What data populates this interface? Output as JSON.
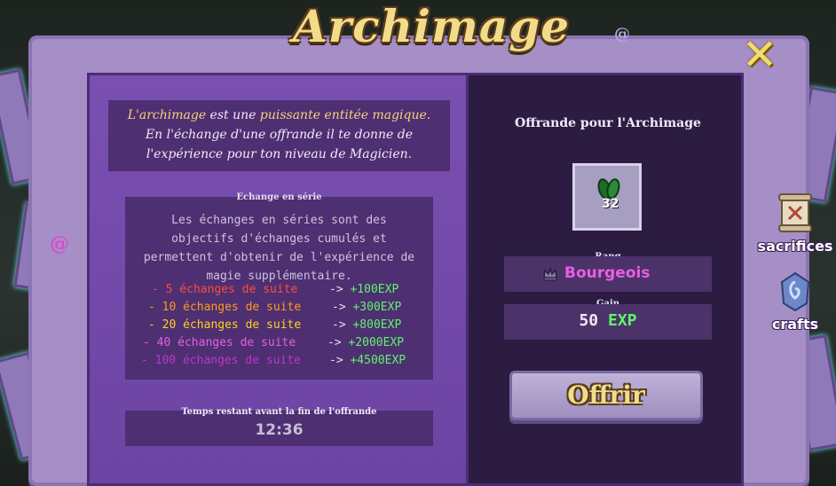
{
  "window": {
    "title": "Archimage",
    "close_glyph": "✕"
  },
  "intro": {
    "line1_a": "L'archimage",
    "line1_b": " est une ",
    "line1_c": "puissante entitée magique.",
    "line2": "En l'échange d'une offrande il te donne de",
    "line3": "l'expérience pour ton niveau de Magicien."
  },
  "series": {
    "title": "Echange en série",
    "description": "Les échanges en séries sont des objectifs d'échanges cumulés et permettent d'obtenir de l'expérience de magie supplémentaire.",
    "rows": [
      {
        "label": "- 5 échanges de suite",
        "arrow": "->",
        "reward": "+100EXP",
        "color": "#ff4d3a"
      },
      {
        "label": "- 10 échanges de suite",
        "arrow": "->",
        "reward": "+300EXP",
        "color": "#ff9a1f"
      },
      {
        "label": "- 20 échanges de suite",
        "arrow": "->",
        "reward": "+800EXP",
        "color": "#ffd21f"
      },
      {
        "label": "- 40 échanges de suite",
        "arrow": "->",
        "reward": "+2000EXP",
        "color": "#e85fe0"
      },
      {
        "label": "- 100 échanges de suite",
        "arrow": "->",
        "reward": "+4500EXP",
        "color": "#b838c9"
      }
    ]
  },
  "timer": {
    "title": "Temps restant avant la fin de l'offrande",
    "value": "12:36"
  },
  "offer": {
    "title": "Offrande pour l'Archimage",
    "item_icon": "green-seeds-icon",
    "item_count": "32",
    "rank_label": "Rang",
    "rank_value": "Bourgeois",
    "rank_icon": "crown-icon",
    "gain_label": "Gain",
    "gain_value": "50",
    "gain_unit": "EXP",
    "button_label": "Offrir"
  },
  "side_tabs": [
    {
      "label": "sacrifices",
      "icon": "scroll-icon"
    },
    {
      "label": "crafts",
      "icon": "rune-stone-icon"
    }
  ]
}
